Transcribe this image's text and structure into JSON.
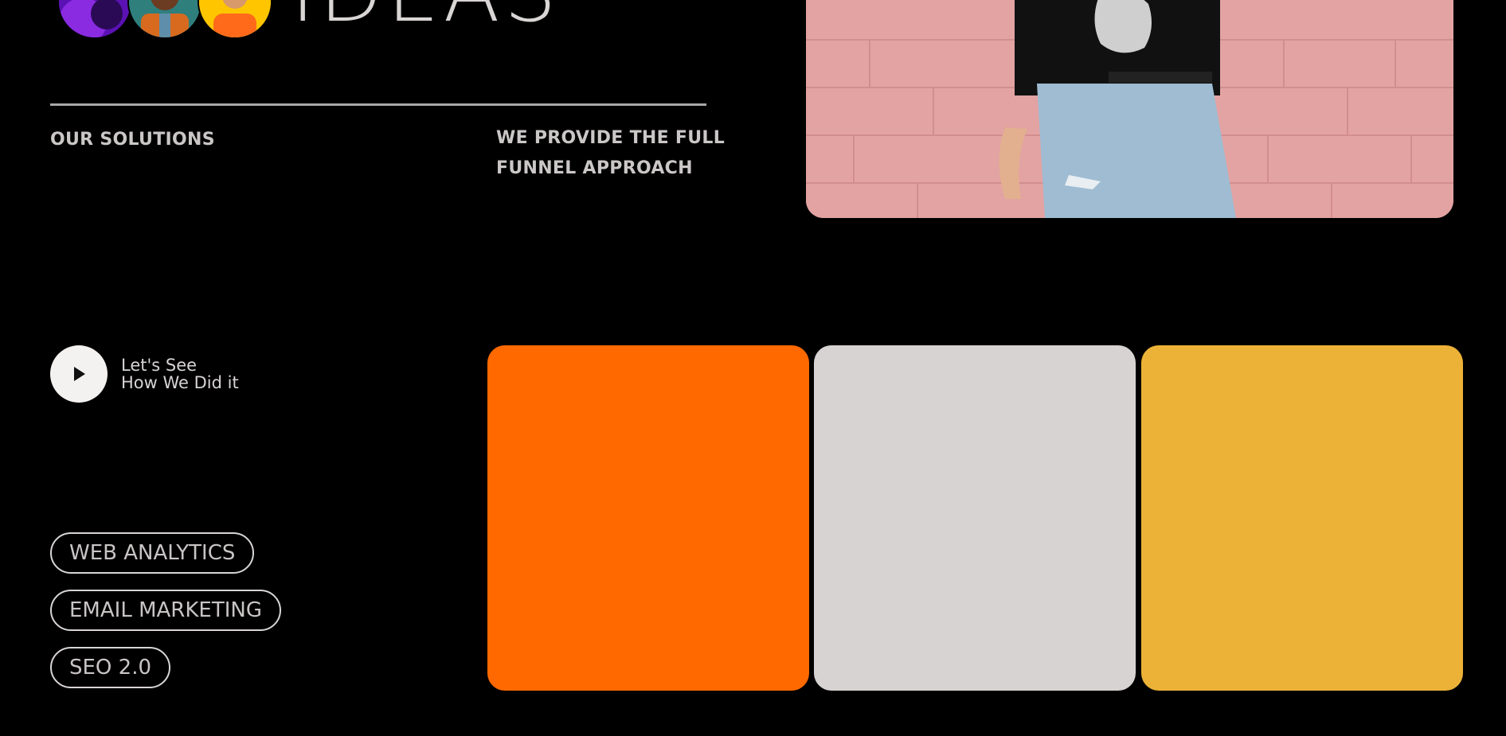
{
  "hero": {
    "headline": "IDEAS"
  },
  "labels": {
    "solutions": "OUR SOLUTIONS",
    "funnel": "WE PROVIDE THE FULL FUNNEL APPROACH"
  },
  "video": {
    "line1": "Let's See",
    "line2": "How We Did it",
    "icon": "play-icon"
  },
  "tags": [
    {
      "label": "WEB ANALYTICS"
    },
    {
      "label": "EMAIL MARKETING"
    },
    {
      "label": "SEO 2.0"
    }
  ],
  "cards": [
    {
      "color": "#ff6900"
    },
    {
      "color": "#d8d3d3"
    },
    {
      "color": "#ecb237"
    }
  ],
  "colors": {
    "background": "#000000",
    "text": "#d6d2d2",
    "divider": "#a9a6a6"
  }
}
